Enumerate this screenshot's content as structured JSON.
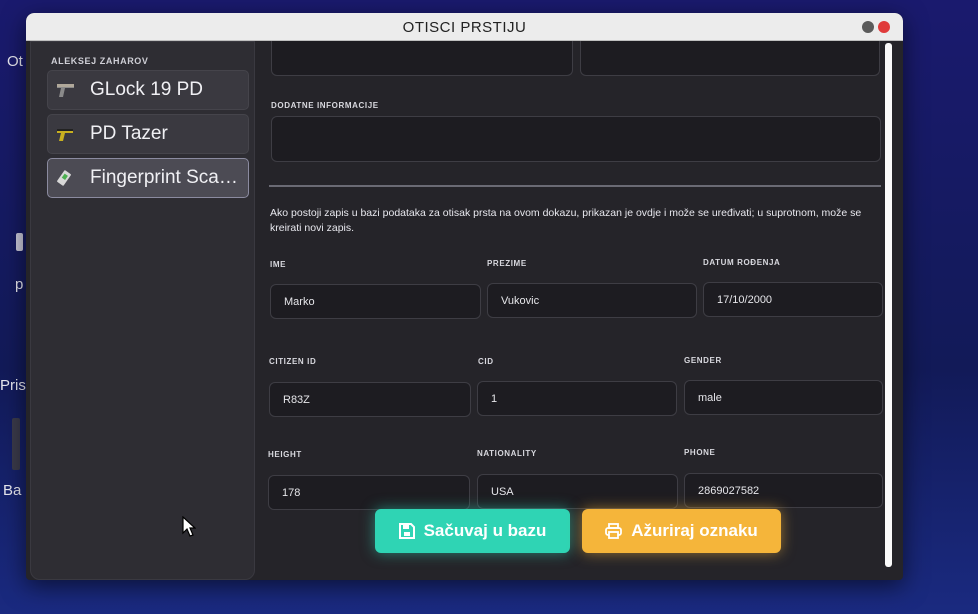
{
  "desktop": {
    "labels": [
      "Ot",
      "p",
      "Pris",
      "Ba"
    ]
  },
  "window": {
    "title": "OTISCI PRSTIJU"
  },
  "sidebar": {
    "user": "ALEKSEJ ZAHAROV",
    "items": [
      {
        "label": "GLock 19 PD",
        "icon": "pistol-icon"
      },
      {
        "label": "PD Tazer",
        "icon": "tazer-icon"
      },
      {
        "label": "Fingerprint Sca…",
        "icon": "fingerprint-scanner-icon"
      }
    ]
  },
  "form": {
    "top_fields": [
      "",
      ""
    ],
    "additional_info_label": "DODATNE INFORMACIJE",
    "additional_info_value": "",
    "description": "Ako postoji zapis u bazi podataka za otisak prsta na ovom dokazu, prikazan je ovdje i može se uređivati; u suprotnom, može se kreirati novi zapis.",
    "fields": [
      {
        "label": "IME",
        "value": "Marko"
      },
      {
        "label": "PREZIME",
        "value": "Vukovic"
      },
      {
        "label": "DATUM ROĐENJA",
        "value": "17/10/2000"
      },
      {
        "label": "CITIZEN ID",
        "value": "R83Z"
      },
      {
        "label": "CID",
        "value": "1"
      },
      {
        "label": "GENDER",
        "value": "male"
      },
      {
        "label": "HEIGHT",
        "value": "178"
      },
      {
        "label": "NATIONALITY",
        "value": "USA"
      },
      {
        "label": "PHONE",
        "value": "2869027582"
      }
    ]
  },
  "buttons": {
    "save_label": "Sačuvaj u bazu",
    "update_label": "Ažuriraj oznaku"
  },
  "colors": {
    "save": "#2fd4b4",
    "update": "#f5b53a"
  }
}
